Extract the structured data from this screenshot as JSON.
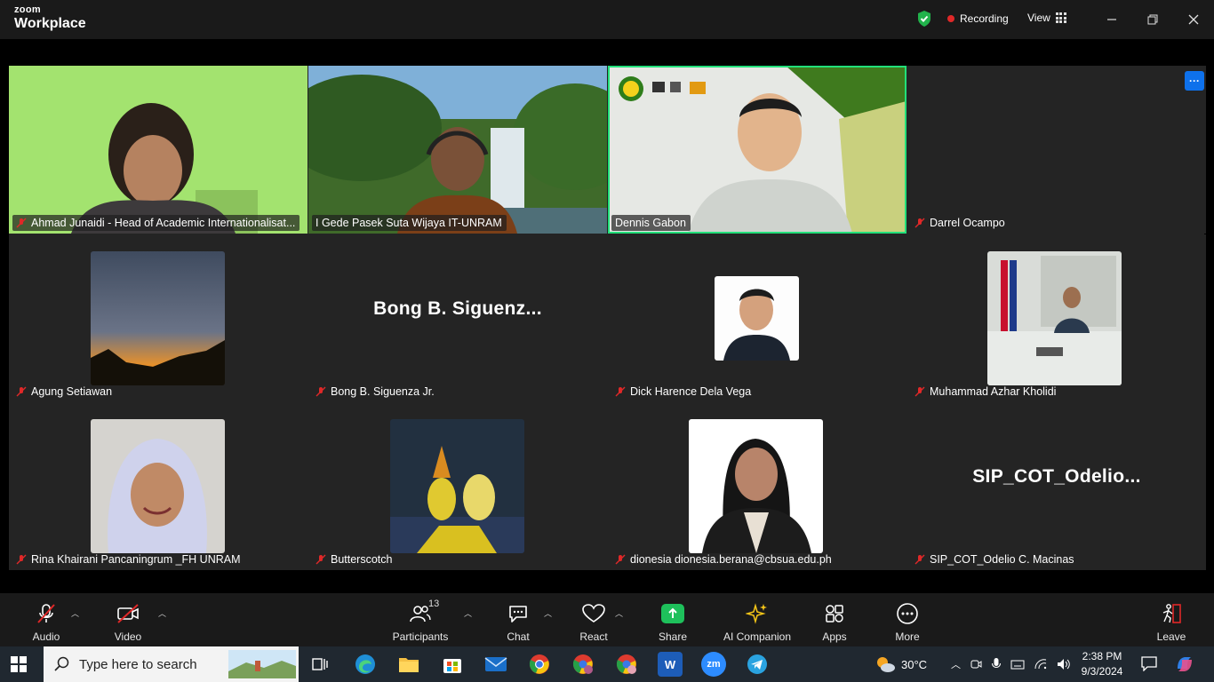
{
  "app": {
    "brand_top": "zoom",
    "brand_bottom": "Workplace"
  },
  "header": {
    "recording_label": "Recording",
    "view_label": "View",
    "icons": [
      "shield-check-icon",
      "grid-icon",
      "minimize-icon",
      "restore-icon",
      "close-icon"
    ]
  },
  "participants": [
    {
      "name": "Ahmad Junaidi - Head of Academic Internationalisat...",
      "muted": true
    },
    {
      "name": "I Gede Pasek Suta Wijaya IT-UNRAM",
      "muted": false
    },
    {
      "name": "Dennis Gabon",
      "muted": false,
      "active_speaker": true
    },
    {
      "name": "Darrel Ocampo",
      "muted": true
    },
    {
      "name": "Agung Setiawan",
      "muted": true
    },
    {
      "name": "Bong B. Siguenza Jr.",
      "muted": true,
      "display_text": "Bong B. Siguenz..."
    },
    {
      "name": "Dick Harence Dela Vega",
      "muted": true
    },
    {
      "name": "Muhammad Azhar Kholidi",
      "muted": true
    },
    {
      "name": "Rina Khairani Pancaningrum _FH UNRAM",
      "muted": true
    },
    {
      "name": "Butterscotch",
      "muted": true
    },
    {
      "name": "dionesia dionesia.berana@cbsua.edu.ph",
      "muted": true
    },
    {
      "name": "SIP_COT_Odelio C. Macinas",
      "muted": true,
      "display_text": "SIP_COT_Odelio..."
    }
  ],
  "gallery": {
    "more_button": "···"
  },
  "toolbar": {
    "audio": "Audio",
    "video": "Video",
    "participants": "Participants",
    "participants_count": "13",
    "chat": "Chat",
    "react": "React",
    "share": "Share",
    "ai_companion": "AI Companion",
    "apps": "Apps",
    "more": "More",
    "leave": "Leave"
  },
  "taskbar": {
    "search_placeholder": "Type here to search",
    "weather": "30°C",
    "time": "2:38 PM",
    "date": "9/3/2024",
    "apps": [
      "task-view-icon",
      "edge-icon",
      "file-explorer-icon",
      "store-icon",
      "mail-icon",
      "chrome-icon",
      "chrome-profile-icon",
      "chrome-profile2-icon",
      "word-icon",
      "zoom-icon",
      "telegram-icon"
    ]
  },
  "colors": {
    "active_speaker": "#22e07a",
    "share_green": "#1ec05b",
    "recording_red": "#e02828",
    "more_blue": "#0e71eb",
    "muted_red": "#e02828"
  }
}
